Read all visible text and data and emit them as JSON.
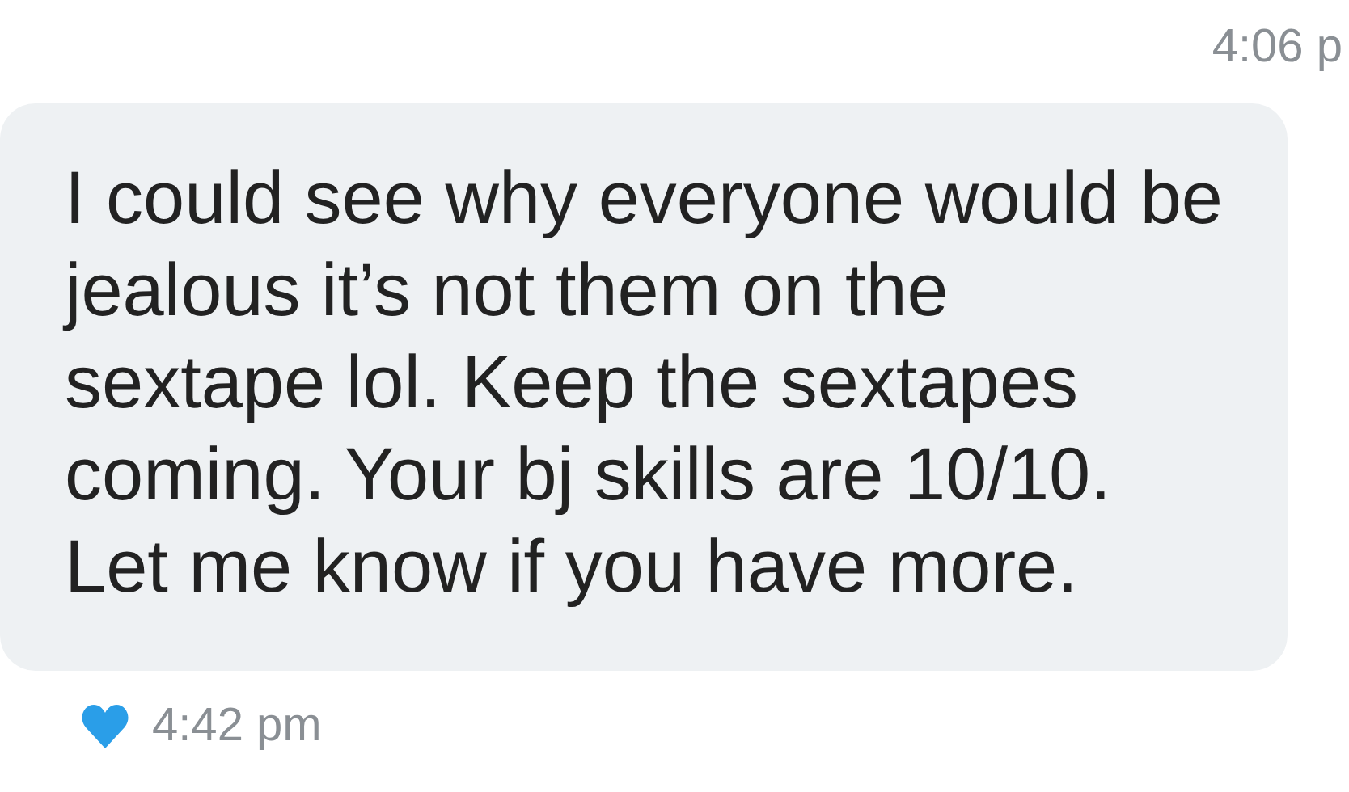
{
  "top_timestamp": "4:06 p",
  "message": {
    "text": "I could see why everyone would be jealous it’s not them on the sextape lol. Keep the sextapes coming. Your bj skills are 10/10. Let me know if you have more.",
    "time": "4:42 pm",
    "liked": true
  }
}
